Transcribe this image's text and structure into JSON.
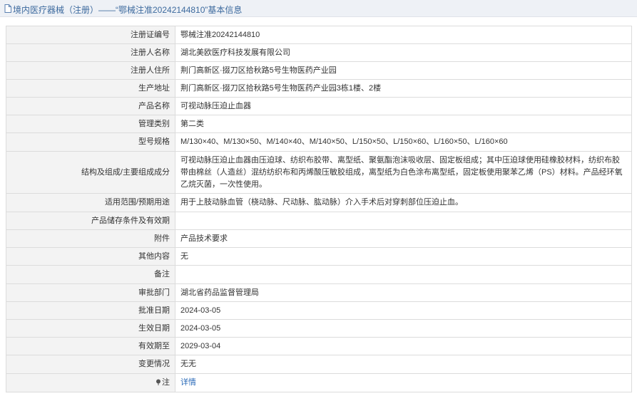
{
  "header": {
    "title": "境内医疗器械（注册）——“鄂械注准20242144810”基本信息"
  },
  "rows": [
    {
      "label": "注册证编号",
      "value": "鄂械注准20242144810"
    },
    {
      "label": "注册人名称",
      "value": "湖北美欧医疗科技发展有限公司"
    },
    {
      "label": "注册人住所",
      "value": "荆门高新区·掇刀区拾秋路5号生物医药产业园"
    },
    {
      "label": "生产地址",
      "value": "荆门高新区·掇刀区拾秋路5号生物医药产业园3栋1楼、2楼"
    },
    {
      "label": "产品名称",
      "value": "可视动脉压迫止血器"
    },
    {
      "label": "管理类别",
      "value": "第二类"
    },
    {
      "label": "型号规格",
      "value": "M/130×40、M/130×50、M/140×40、M/140×50、L/150×50、L/150×60、L/160×50、L/160×60"
    },
    {
      "label": "结构及组成/主要组成成分",
      "value": "可视动脉压迫止血器由压迫球、纺织布胶带、离型纸、聚氨酯泡沫吸收层、固定板组成；其中压迫球使用硅橡胶材料，纺织布胶带由棉丝（人造丝）混纺纺织布和丙烯酸压敏胶组成，离型纸为白色涂布离型纸，固定板使用聚苯乙烯（PS）材料。产品经环氧乙烷灭菌，一次性使用。"
    },
    {
      "label": "适用范围/预期用途",
      "value": "用于上肢动脉血管（桡动脉、尺动脉、肱动脉）介入手术后对穿刺部位压迫止血。"
    },
    {
      "label": "产品储存条件及有效期",
      "value": ""
    },
    {
      "label": "附件",
      "value": "产品技术要求"
    },
    {
      "label": "其他内容",
      "value": "无"
    },
    {
      "label": "备注",
      "value": ""
    },
    {
      "label": "审批部门",
      "value": "湖北省药品监督管理局"
    },
    {
      "label": "批准日期",
      "value": "2024-03-05"
    },
    {
      "label": "生效日期",
      "value": "2024-03-05"
    },
    {
      "label": "有效期至",
      "value": "2029-03-04"
    },
    {
      "label": "变更情况",
      "value": "无无"
    }
  ],
  "note": {
    "label": "注",
    "link": "详情",
    "icon": "pin-icon"
  },
  "colors": {
    "title": "#3d6a9e",
    "link": "#2a6ab8",
    "label_bg": "#f3f3f3",
    "border": "#dcdcdc",
    "topbar_bg": "#eef1f6"
  }
}
